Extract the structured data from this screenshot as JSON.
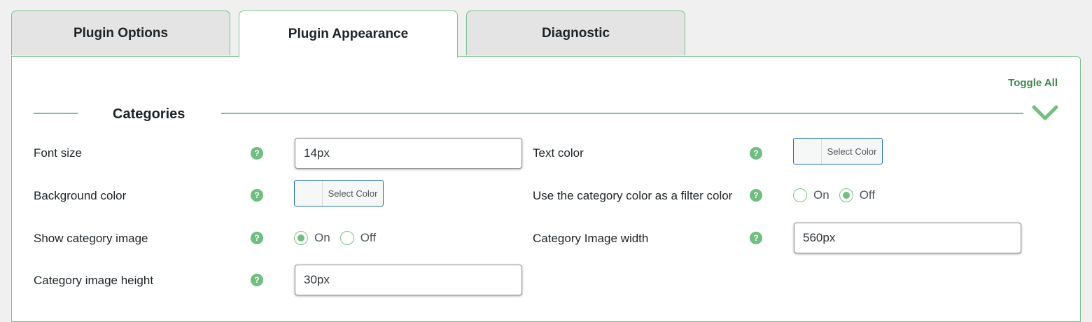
{
  "tabs": [
    {
      "label": "Plugin Options",
      "active": false
    },
    {
      "label": "Plugin Appearance",
      "active": true
    },
    {
      "label": "Diagnostic",
      "active": false
    }
  ],
  "panel": {
    "toggle_all": "Toggle All",
    "section_title": "Categories",
    "chevron_icon": "chevron-down-icon"
  },
  "fields": {
    "font_size": {
      "label": "Font size",
      "value": "14px"
    },
    "text_color": {
      "label": "Text color",
      "button": "Select Color"
    },
    "background_color": {
      "label": "Background color",
      "button": "Select Color"
    },
    "category_filter_color": {
      "label": "Use the category color as a filter color",
      "on": "On",
      "off": "Off",
      "selected": "Off"
    },
    "show_category_image": {
      "label": "Show category image",
      "on": "On",
      "off": "Off",
      "selected": "On"
    },
    "category_image_width": {
      "label": "Category Image width",
      "value": "560px"
    },
    "category_image_height": {
      "label": "Category image height",
      "value": "30px"
    }
  },
  "help_icon": "?",
  "colors": {
    "accent": "#7cc38a",
    "help": "#6fbf7e",
    "link": "#3a8a4e"
  }
}
